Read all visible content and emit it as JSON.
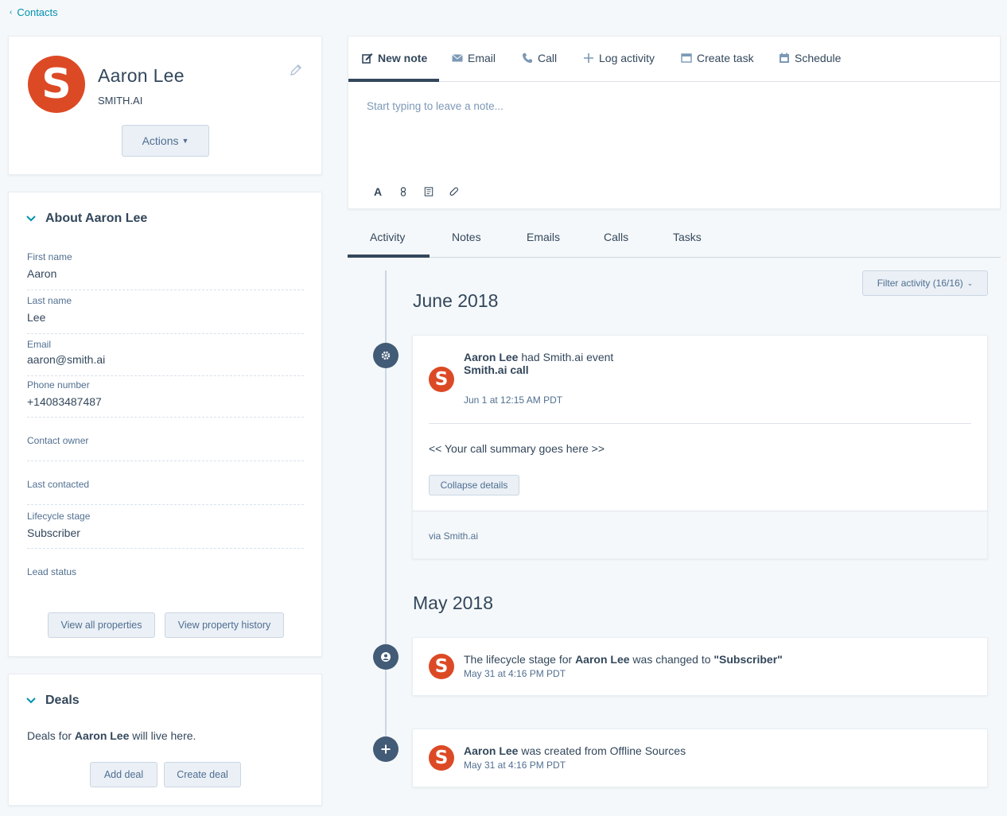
{
  "breadcrumb": {
    "back_label": "Contacts"
  },
  "profile": {
    "initial": "S",
    "name": "Aaron Lee",
    "company": "SMITH.AI",
    "actions_label": "Actions",
    "accent_color": "#dc4a25"
  },
  "about": {
    "title": "About Aaron Lee",
    "properties": [
      {
        "label": "First name",
        "value": "Aaron"
      },
      {
        "label": "Last name",
        "value": "Lee"
      },
      {
        "label": "Email",
        "value": "aaron@smith.ai"
      },
      {
        "label": "Phone number",
        "value": "+14083487487"
      },
      {
        "label": "Contact owner",
        "value": ""
      },
      {
        "label": "Last contacted",
        "value": ""
      },
      {
        "label": "Lifecycle stage",
        "value": "Subscriber"
      },
      {
        "label": "Lead status",
        "value": ""
      }
    ],
    "view_all_label": "View all properties",
    "view_history_label": "View property history"
  },
  "deals": {
    "title": "Deals",
    "text_before": "Deals for ",
    "text_name": "Aaron Lee",
    "text_after": " will live here.",
    "add_label": "Add deal",
    "create_label": "Create deal"
  },
  "composer": {
    "tabs": [
      {
        "label": "New note",
        "icon": "edit-icon"
      },
      {
        "label": "Email",
        "icon": "envelope-icon"
      },
      {
        "label": "Call",
        "icon": "phone-icon"
      },
      {
        "label": "Log activity",
        "icon": "plus-icon"
      },
      {
        "label": "Create task",
        "icon": "task-icon"
      },
      {
        "label": "Schedule",
        "icon": "calendar-icon"
      }
    ],
    "placeholder": "Start typing to leave a note..."
  },
  "activity_tabs": [
    "Activity",
    "Notes",
    "Emails",
    "Calls",
    "Tasks"
  ],
  "filter_label": "Filter activity (16/16)",
  "timeline": {
    "months": [
      "June 2018",
      "May 2018"
    ],
    "event1": {
      "actor": "Aaron Lee",
      "text": " had Smith.ai event",
      "subtitle": "Smith.ai call",
      "time": "Jun 1 at 12:15 AM PDT",
      "summary": "<< Your call summary goes here >>",
      "collapse_label": "Collapse details",
      "via": "via Smith.ai"
    },
    "event2": {
      "text_before": "The lifecycle stage for ",
      "actor": "Aaron Lee",
      "text_middle": " was changed to ",
      "value": "\"Subscriber\"",
      "time": "May 31 at 4:16 PM PDT"
    },
    "event3": {
      "actor": "Aaron Lee",
      "text": " was created from Offline Sources",
      "time": "May 31 at 4:16 PM PDT"
    }
  }
}
